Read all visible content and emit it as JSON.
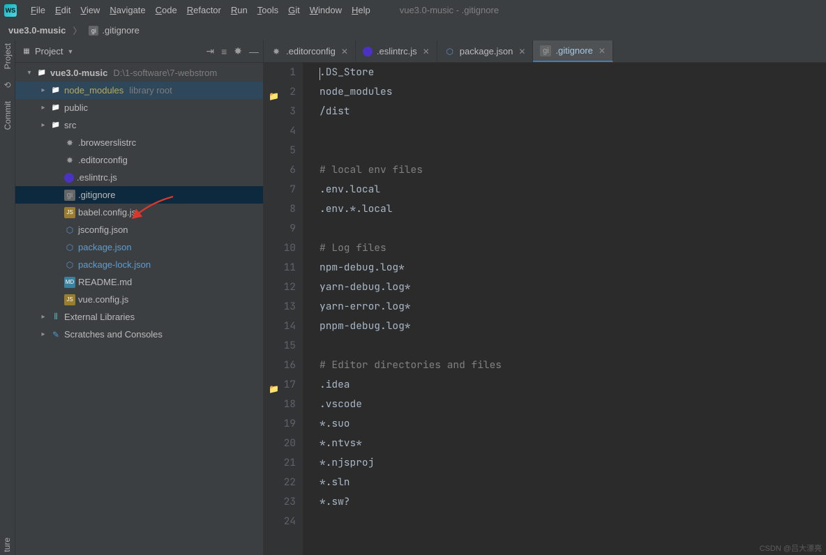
{
  "window": {
    "title": "vue3.0-music - .gitignore"
  },
  "menu": [
    "File",
    "Edit",
    "View",
    "Navigate",
    "Code",
    "Refactor",
    "Run",
    "Tools",
    "Git",
    "Window",
    "Help"
  ],
  "breadcrumbs": {
    "root": "vue3.0-music",
    "file": ".gitignore"
  },
  "leftRail": {
    "project": "Project",
    "commit": "Commit",
    "structure": "ture"
  },
  "panel": {
    "title": "Project",
    "root": {
      "name": "vue3.0-music",
      "path": "D:\\1-software\\7-webstrom"
    },
    "children": [
      {
        "name": "node_modules",
        "note": "library root",
        "type": "folder",
        "yellow": true,
        "highlighted": true
      },
      {
        "name": "public",
        "type": "folder"
      },
      {
        "name": "src",
        "type": "folder"
      }
    ],
    "files": [
      {
        "name": ".browserslistrc",
        "icon": "cfg"
      },
      {
        "name": ".editorconfig",
        "icon": "cfg"
      },
      {
        "name": ".eslintrc.js",
        "icon": "eslint"
      },
      {
        "name": ".gitignore",
        "icon": "git",
        "selected": true
      },
      {
        "name": "babel.config.js",
        "icon": "js"
      },
      {
        "name": "jsconfig.json",
        "icon": "json"
      },
      {
        "name": "package.json",
        "icon": "json",
        "blue": true
      },
      {
        "name": "package-lock.json",
        "icon": "json",
        "blue": true
      },
      {
        "name": "README.md",
        "icon": "md"
      },
      {
        "name": "vue.config.js",
        "icon": "js"
      }
    ],
    "extra": [
      {
        "name": "External Libraries",
        "icon": "lib"
      },
      {
        "name": "Scratches and Consoles",
        "icon": "scratch"
      }
    ]
  },
  "tabs": [
    {
      "label": ".editorconfig",
      "icon": "cfg"
    },
    {
      "label": ".eslintrc.js",
      "icon": "eslint"
    },
    {
      "label": "package.json",
      "icon": "json"
    },
    {
      "label": ".gitignore",
      "icon": "git",
      "active": true
    }
  ],
  "codeLines": [
    ".DS_Store",
    "node_modules",
    "/dist",
    "",
    "",
    "# local env files",
    ".env.local",
    ".env.*.local",
    "",
    "# Log files",
    "npm-debug.log*",
    "yarn-debug.log*",
    "yarn-error.log*",
    "pnpm-debug.log*",
    "",
    "# Editor directories and files",
    ".idea",
    ".vscode",
    "*.suo",
    "*.ntvs*",
    "*.njsproj",
    "*.sln",
    "*.sw?",
    ""
  ],
  "gutterFolderLines": [
    2,
    17
  ],
  "watermark": "CSDN @吕大漂亮"
}
